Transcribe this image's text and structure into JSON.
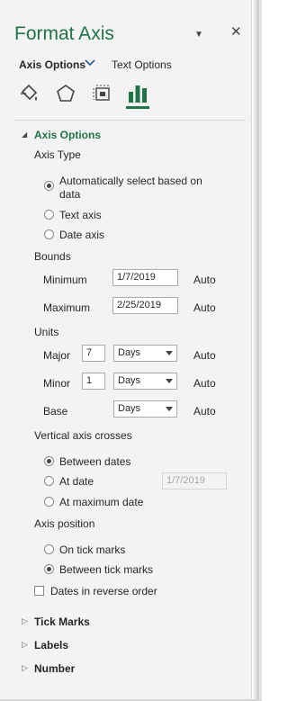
{
  "header": {
    "title": "Format Axis",
    "dropdown_glyph": "▼",
    "close_glyph": "✕"
  },
  "tabs": {
    "active_label": "Axis Options",
    "chevron": "⌄",
    "other_label": "Text Options"
  },
  "icons": [
    "fill-line-icon",
    "effects-pentagon-icon",
    "size-properties-icon",
    "axis-options-bar-chart-icon"
  ],
  "colors": {
    "accent": "#217346",
    "pane_bg": "#f3f3f3"
  },
  "axis_options": {
    "title": "Axis Options",
    "axis_type": {
      "label": "Axis Type",
      "options": [
        "Automatically select based on",
        "data",
        "Text axis",
        "Date axis"
      ],
      "selected": "Automatically select based on data"
    },
    "bounds": {
      "label": "Bounds",
      "minimum_label": "Minimum",
      "minimum_value": "1/7/2019",
      "minimum_auto": "Auto",
      "maximum_label": "Maximum",
      "maximum_value": "2/25/2019",
      "maximum_auto": "Auto"
    },
    "units": {
      "label": "Units",
      "major_label": "Major",
      "major_value": "7",
      "major_unit": "Days",
      "major_auto": "Auto",
      "minor_label": "Minor",
      "minor_value": "1",
      "minor_unit": "Days",
      "minor_auto": "Auto",
      "base_label": "Base",
      "base_unit": "Days",
      "base_auto": "Auto"
    },
    "vertical_axis_crosses": {
      "label": "Vertical axis crosses",
      "between_dates": "Between dates",
      "at_date": "At date",
      "at_date_value": "1/7/2019",
      "at_maximum_date": "At maximum date",
      "selected": "Between dates"
    },
    "axis_position": {
      "label": "Axis position",
      "on_tick_marks": "On tick marks",
      "between_tick_marks": "Between tick marks",
      "selected": "Between tick marks"
    },
    "reverse_order_label": "Dates in reverse order"
  },
  "collapsed_sections": [
    "Tick Marks",
    "Labels",
    "Number"
  ]
}
